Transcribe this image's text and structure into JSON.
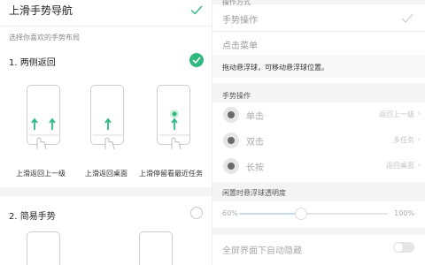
{
  "left": {
    "title": "上滑手势导航",
    "hint": "选择你喜欢的手势布局",
    "options": [
      {
        "label": "1. 两侧返回",
        "selected": true
      },
      {
        "label": "2. 简易手势",
        "selected": false
      }
    ],
    "captions": [
      "上滑返回上一级",
      "上滑返回桌面",
      "上滑停留看最近任务"
    ],
    "accent": "#2fb981"
  },
  "right": {
    "section_top": "操作方式",
    "item_gesture": "手势操作",
    "item_menu": "点击菜单",
    "note": "拖动悬浮球，可移动悬浮球位置。",
    "section_gesture": "手势操作",
    "rows": [
      {
        "label": "单击",
        "value": "返回上一级"
      },
      {
        "label": "双击",
        "value": "多任务"
      },
      {
        "label": "长按",
        "value": "返回桌面"
      }
    ],
    "opacity_section": "闲置时悬浮球透明度",
    "opacity_min": "60%",
    "opacity_max": "100%",
    "opacity_value_percent": 60,
    "auto_hide": "全屏界面下自动隐藏",
    "auto_hide_on": false
  }
}
